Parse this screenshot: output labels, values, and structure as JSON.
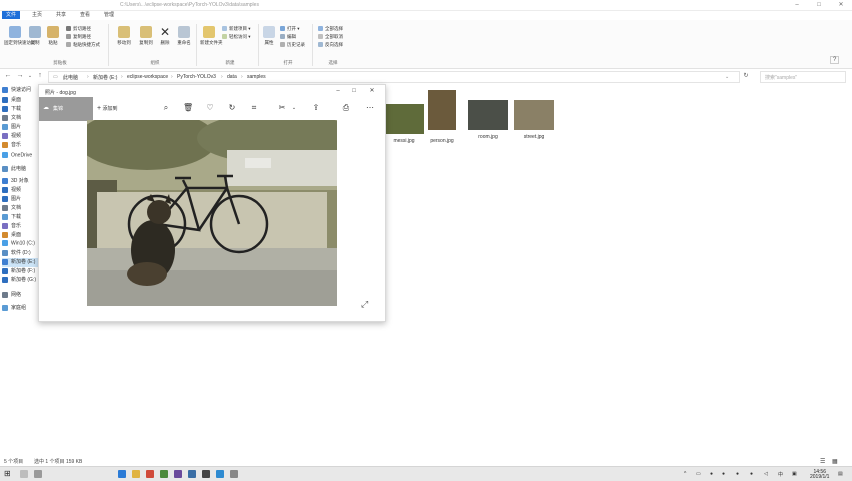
{
  "window": {
    "title": "C:\\Users\\...\\eclipse-workspace\\PyTorch-YOLOv3\\data\\samples"
  },
  "ribbon_tabs": [
    {
      "label": "文件",
      "active": true
    },
    {
      "label": "主页",
      "active": false
    },
    {
      "label": "共享",
      "active": false
    },
    {
      "label": "查看",
      "active": false
    },
    {
      "label": "管理",
      "active": false
    }
  ],
  "ribbon": {
    "pin": "固定到快速访问",
    "copy": "复制",
    "paste": "粘贴",
    "cut": "剪切路径",
    "copy_path": "复制路径",
    "paste_shortcut": "粘贴快捷方式",
    "move_to": "移动到",
    "copy_to": "复制到",
    "delete": "删除",
    "rename": "重命名",
    "new_folder": "新建文件夹",
    "new_item": "新建项目",
    "easy_access": "轻松访问",
    "properties": "属性",
    "open": "打开",
    "edit": "编辑",
    "history": "历史记录",
    "select_all": "全部选择",
    "select_none": "全部取消",
    "invert": "反向选择",
    "groups": {
      "clipboard": "剪贴板",
      "organize": "组织",
      "new": "新建",
      "open": "打开",
      "select": "选择"
    }
  },
  "address": {
    "crumbs": [
      "此电脑",
      "新加卷 (E:)",
      "eclipse-workspace",
      "PyTorch-YOLOv3",
      "data",
      "samples"
    ],
    "search_placeholder": "搜索\"samples\""
  },
  "nav_pane": [
    "快速访问",
    "桌面",
    "下载",
    "文档",
    "图片",
    "视频",
    "音乐",
    "OneDrive",
    "此电脑",
    "3D 对象",
    "视频",
    "图片",
    "文档",
    "下载",
    "音乐",
    "桌面",
    "Win10 (C:)",
    "软件 (D:)",
    "新加卷 (E:)",
    "新加卷 (F:)",
    "新加卷 (G:)",
    "网络",
    "家庭组"
  ],
  "thumbnails": [
    {
      "name": "messi.jpg",
      "color": "#5f6b3a"
    },
    {
      "name": "person.jpg",
      "color": "#6b5a3c"
    },
    {
      "name": "room.jpg",
      "color": "#4b4f48"
    },
    {
      "name": "street.jpg",
      "color": "#8a8066"
    }
  ],
  "photos_app": {
    "title": "照片 - dog.jpg",
    "collection": "集锦",
    "add_to": "添加到",
    "toolbar_icons": [
      "zoom-icon",
      "delete-icon",
      "favorite-icon",
      "rotate-icon",
      "crop-icon",
      "edit-icon",
      "share-icon",
      "print-icon",
      "more-icon"
    ]
  },
  "status_bar": {
    "count": "5 个项目",
    "selected": "选中 1 个项目  159 KB"
  },
  "taskbar": {
    "time": "14:56",
    "date": "2019/1/1"
  },
  "colors": {
    "accent": "#1e6fd9",
    "collection_bg": "#9a9a9a"
  }
}
